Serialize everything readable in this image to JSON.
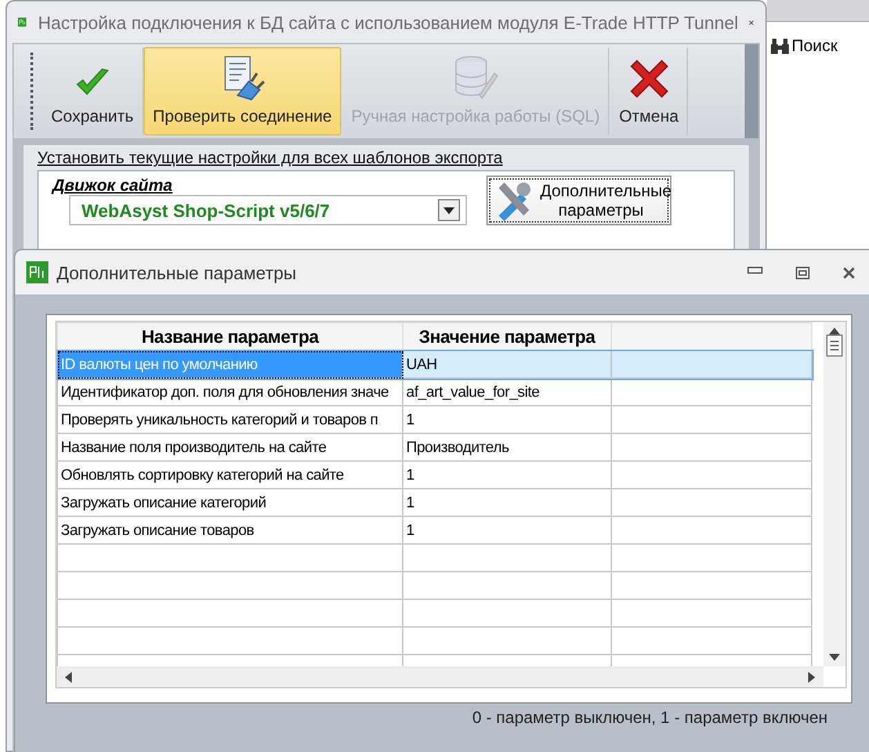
{
  "main_window": {
    "title": "Настройка подключения к БД сайта с использованием модуля E-Trade HTTP Tunnel",
    "toolbar": [
      {
        "label": "Сохранить",
        "kind": "save",
        "selected": false,
        "disabled": false
      },
      {
        "label": "Проверить соединение",
        "kind": "test",
        "selected": true,
        "disabled": false
      },
      {
        "label": "Ручная настройка работы (SQL)",
        "kind": "sql",
        "selected": false,
        "disabled": true
      },
      {
        "label": "Отмена",
        "kind": "cancel",
        "selected": false,
        "disabled": false
      }
    ],
    "apply_all_link": "Установить текущие настройки для всех шаблонов экспорта",
    "engine_label": "Движок сайта",
    "engine_select": {
      "value": "WebAsyst Shop-Script v5/6/7"
    },
    "extra_button": "Дополнительные параметры"
  },
  "side_panel": {
    "search": "Поиск"
  },
  "dialog": {
    "title": "Дополнительные параметры",
    "table": {
      "columns": [
        "Название параметра",
        "Значение параметра"
      ],
      "rows": [
        {
          "name": "ID валюты цен по умолчанию",
          "value": "UAH",
          "selected": true
        },
        {
          "name": "Идентификатор доп. поля для обновления значе",
          "value": "af_art_value_for_site",
          "selected": false
        },
        {
          "name": "Проверять уникальность категорий и товаров п",
          "value": "1",
          "selected": false
        },
        {
          "name": "Название поля производитель на сайте",
          "value": "Производитель",
          "selected": false
        },
        {
          "name": "Обновлять сортировку категорий на сайте",
          "value": "1",
          "selected": false
        },
        {
          "name": "Загружать описание категорий",
          "value": "1",
          "selected": false
        },
        {
          "name": "Загружать описание товаров",
          "value": "1",
          "selected": false
        }
      ]
    },
    "status_bar": "0 - параметр выключен, 1 - параметр включен"
  }
}
